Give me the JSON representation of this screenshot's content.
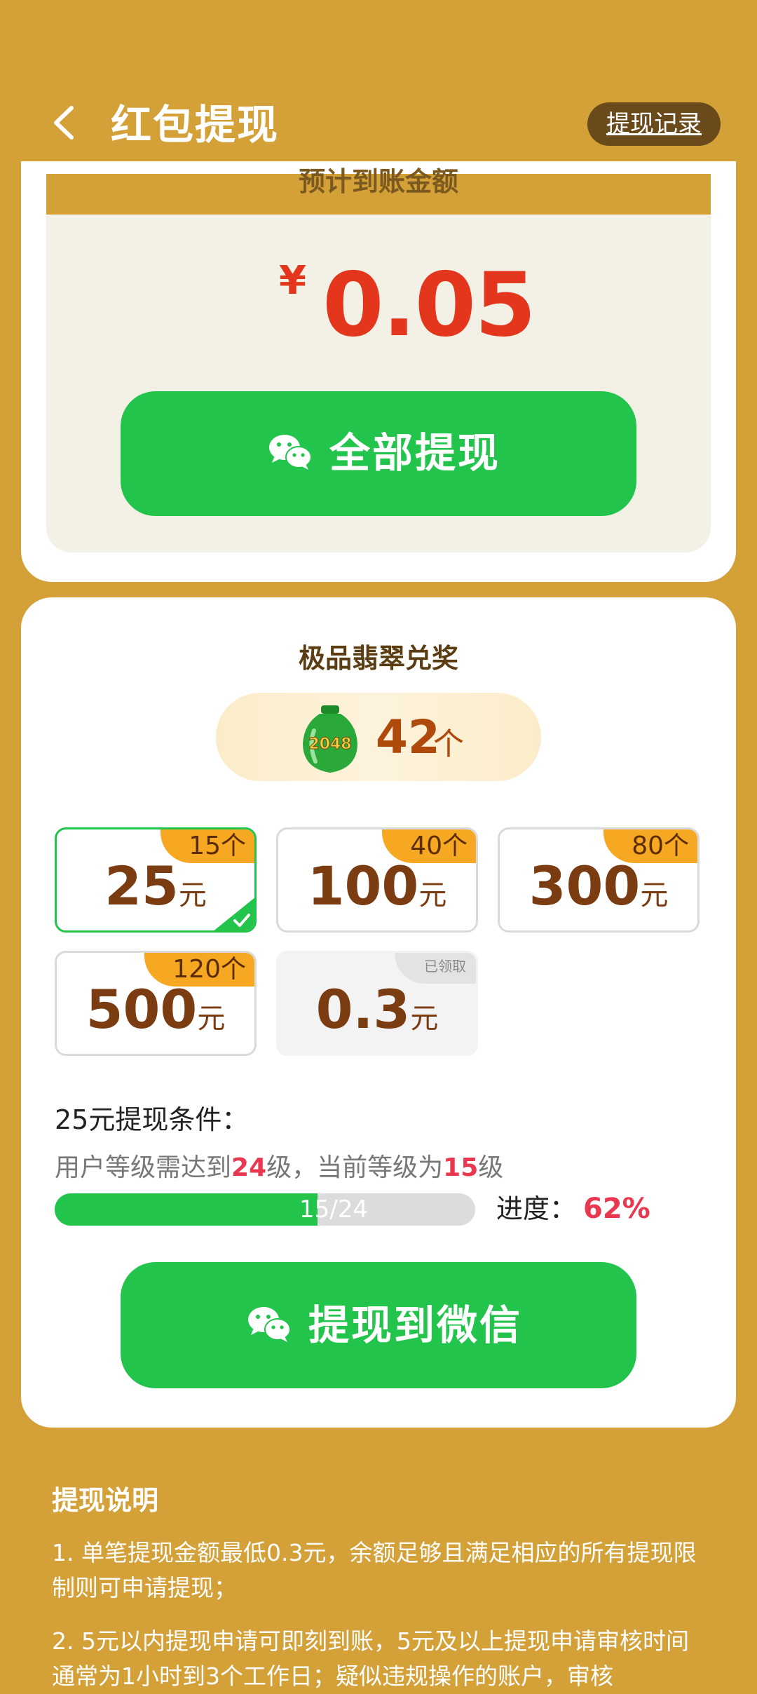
{
  "header": {
    "title": "红包提现",
    "record_button": "提现记录"
  },
  "balance": {
    "label": "预计到账金额",
    "currency": "¥",
    "amount": "0.05",
    "withdraw_all_label": "全部提现"
  },
  "emerald": {
    "title": "极品翡翠兑奖",
    "jar_text": "2048",
    "count": "42",
    "count_unit": "个"
  },
  "options": [
    {
      "amount": "25",
      "unit": "元",
      "cost": "15个",
      "selected": true
    },
    {
      "amount": "100",
      "unit": "元",
      "cost": "40个"
    },
    {
      "amount": "300",
      "unit": "元",
      "cost": "80个"
    },
    {
      "amount": "500",
      "unit": "元",
      "cost": "120个"
    },
    {
      "amount": "0.3",
      "unit": "元",
      "claimed_label": "已领取"
    }
  ],
  "condition": {
    "title": "25元提现条件：",
    "text_prefix": "用户等级需达到",
    "required_level": "24",
    "text_middle": "级，当前等级为",
    "current_level": "15",
    "text_suffix": "级",
    "progress_text": "15/24",
    "progress_fraction": 0.625,
    "progress_label": "进度：",
    "progress_percent": "62%"
  },
  "withdraw_wechat_label": "提现到微信",
  "notes": {
    "title": "提现说明",
    "items": [
      "1. 单笔提现金额最低0.3元，余额足够且满足相应的所有提现限制则可申请提现；",
      "2. 5元以内提现申请可即刻到账，5元及以上提现申请审核时间通常为1小时到3个工作日；疑似违规操作的账户，审核"
    ]
  },
  "colors": {
    "background": "#d4a038",
    "green": "#22c44c",
    "red": "#e3361c",
    "accent_orange": "#f6a823"
  }
}
